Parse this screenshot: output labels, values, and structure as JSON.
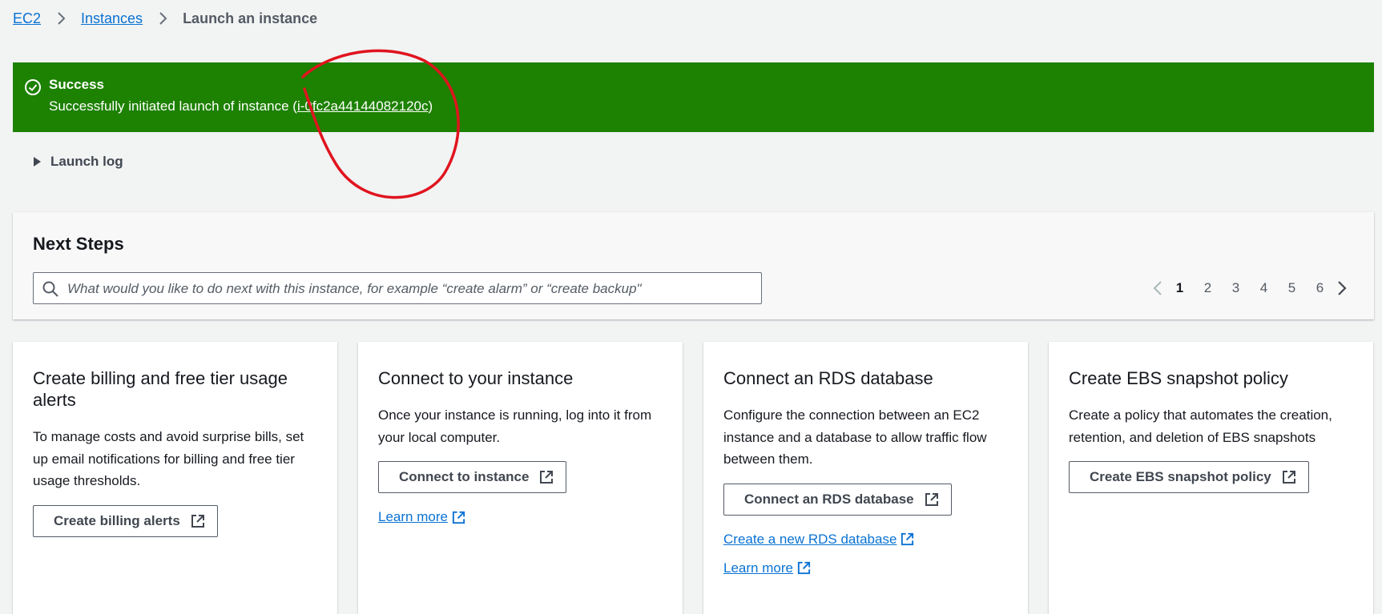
{
  "breadcrumb": {
    "items": [
      "EC2",
      "Instances"
    ],
    "current": "Launch an instance"
  },
  "flash": {
    "type": "success",
    "title": "Success",
    "message_prefix": "Successfully initiated launch of instance (",
    "instance_id": "i-0fc2a44144082120c",
    "message_suffix": ")",
    "color": "#1d8102"
  },
  "launch_log": {
    "label": "Launch log"
  },
  "next_steps": {
    "title": "Next Steps",
    "search_placeholder": "What would you like to do next with this instance, for example “create alarm” or “create backup\"",
    "pagination": {
      "pages": [
        "1",
        "2",
        "3",
        "4",
        "5",
        "6"
      ],
      "current": "1"
    }
  },
  "cards": [
    {
      "title": "Create billing and free tier usage alerts",
      "description": "To manage costs and avoid surprise bills, set up email notifications for billing and free tier usage thresholds.",
      "button": "Create billing alerts"
    },
    {
      "title": "Connect to your instance",
      "description": "Once your instance is running, log into it from your local computer.",
      "button": "Connect to instance",
      "links": [
        "Learn more"
      ]
    },
    {
      "title": "Connect an RDS database",
      "description": "Configure the connection between an EC2 instance and a database to allow traffic flow between them.",
      "button": "Connect an RDS database",
      "links": [
        "Create a new RDS database",
        "Learn more"
      ]
    },
    {
      "title": "Create EBS snapshot policy",
      "description": "Create a policy that automates the creation, retention, and deletion of EBS snapshots",
      "button": "Create EBS snapshot policy"
    }
  ],
  "colors": {
    "link": "#0972d3",
    "annotation": "#e0141e"
  }
}
